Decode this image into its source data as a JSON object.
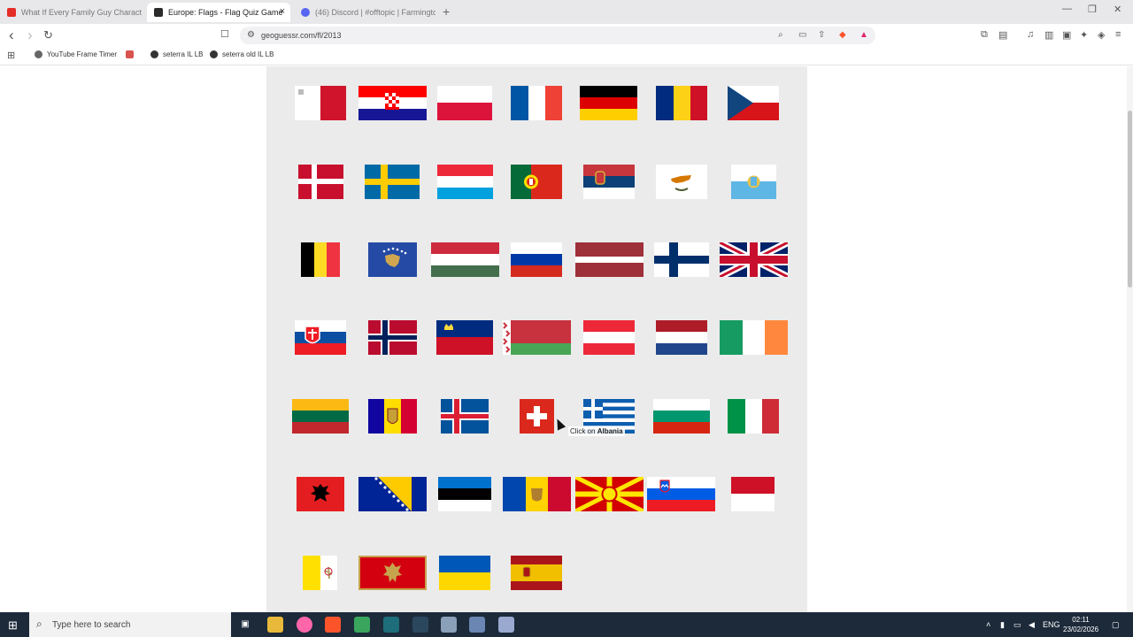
{
  "browser": {
    "tabs": [
      {
        "label": "What If Every Family Guy Character W",
        "fav_color": "#e52d27",
        "active": false
      },
      {
        "label": "Europe: Flags - Flag Quiz Game",
        "fav_color": "#2b2b2b",
        "active": true
      },
      {
        "label": "(46) Discord | #offtopic | Farmington",
        "fav_color": "#5865f2",
        "active": false
      }
    ],
    "tab_close": "×",
    "new_tab": "+",
    "window_controls": {
      "minimize": "—",
      "restore": "❐",
      "close": "✕"
    },
    "nav": {
      "back": "‹",
      "forward": "›",
      "reload": "↻",
      "bookmark": "☐"
    },
    "address": "geoguessr.com/fl/2013",
    "bookmarks": [
      {
        "label": "YouTube Frame Timer"
      },
      {
        "label": ""
      },
      {
        "label": "seterra IL LB"
      },
      {
        "label": "seterra old IL LB"
      }
    ]
  },
  "quiz": {
    "tooltip_prefix": "Click on ",
    "tooltip_target": "Albania",
    "flags": [
      {
        "id": "malta"
      },
      {
        "id": "croatia"
      },
      {
        "id": "poland"
      },
      {
        "id": "france"
      },
      {
        "id": "germany"
      },
      {
        "id": "romania"
      },
      {
        "id": "czechia"
      },
      {
        "id": "denmark"
      },
      {
        "id": "sweden"
      },
      {
        "id": "luxembourg"
      },
      {
        "id": "portugal"
      },
      {
        "id": "serbia"
      },
      {
        "id": "cyprus"
      },
      {
        "id": "san-marino"
      },
      {
        "id": "belgium"
      },
      {
        "id": "kosovo"
      },
      {
        "id": "hungary"
      },
      {
        "id": "russia"
      },
      {
        "id": "latvia"
      },
      {
        "id": "finland"
      },
      {
        "id": "united-kingdom"
      },
      {
        "id": "slovakia"
      },
      {
        "id": "norway"
      },
      {
        "id": "liechtenstein"
      },
      {
        "id": "belarus"
      },
      {
        "id": "austria"
      },
      {
        "id": "netherlands"
      },
      {
        "id": "ireland"
      },
      {
        "id": "lithuania"
      },
      {
        "id": "andorra"
      },
      {
        "id": "iceland"
      },
      {
        "id": "switzerland"
      },
      {
        "id": "greece"
      },
      {
        "id": "bulgaria"
      },
      {
        "id": "italy"
      },
      {
        "id": "albania"
      },
      {
        "id": "bosnia-and-herzegovina"
      },
      {
        "id": "estonia"
      },
      {
        "id": "moldova"
      },
      {
        "id": "north-macedonia"
      },
      {
        "id": "slovenia"
      },
      {
        "id": "monaco"
      },
      {
        "id": "vatican-city"
      },
      {
        "id": "montenegro"
      },
      {
        "id": "ukraine"
      },
      {
        "id": "spain"
      }
    ]
  },
  "taskbar": {
    "search_placeholder": "Type here to search",
    "language": "ENG",
    "time": "02:11",
    "date": "23/02/2026"
  }
}
